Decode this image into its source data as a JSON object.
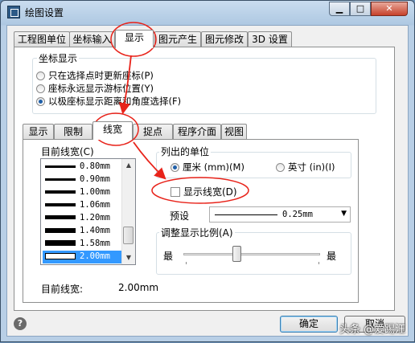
{
  "window": {
    "title": "绘图设置",
    "min_glyph": "▁",
    "max_glyph": "□",
    "close_glyph": "✕"
  },
  "top_tabs": [
    "工程图单位",
    "坐标输入",
    "显示",
    "图元产生",
    "图元修改",
    "3D 设置"
  ],
  "coord_display": {
    "label": "坐标显示",
    "options": [
      "只在选择点时更新座标(P)",
      "座标永远显示游标位置(Y)",
      "以极座标显示距离和角度选择(F)"
    ],
    "selected_index": 2
  },
  "inner_tabs": [
    "显示",
    "限制",
    "线宽",
    "捉点",
    "程序介面",
    "视图"
  ],
  "current_width": {
    "label": "目前线宽(C)",
    "items": [
      "0.80mm",
      "0.90mm",
      "1.00mm",
      "1.06mm",
      "1.20mm",
      "1.40mm",
      "1.58mm",
      "2.00mm"
    ],
    "selected_index": 7,
    "scroll_up": "▲",
    "scroll_down": "▼",
    "footer_label": "目前线宽:",
    "footer_value": "2.00mm"
  },
  "units": {
    "label": "列出的单位",
    "mm": "厘米 (mm)(M)",
    "inch": "英寸 (in)(I)",
    "selected": "mm"
  },
  "show_lineweight": {
    "label": "显示线宽(D)",
    "checked": false
  },
  "preset": {
    "label": "预设",
    "value": "0.25mm",
    "arrow": "▼"
  },
  "scale": {
    "label": "调整显示比例(A)",
    "min_label": "最",
    "max_label": "最"
  },
  "buttons": {
    "ok": "确定",
    "cancel": "取消",
    "help": "?"
  },
  "watermark": "头条 @爱踢汪",
  "colors": {
    "annotation_red": "#e8231a",
    "selection_blue": "#3399ff",
    "radio_blue": "#1f5fa8"
  }
}
